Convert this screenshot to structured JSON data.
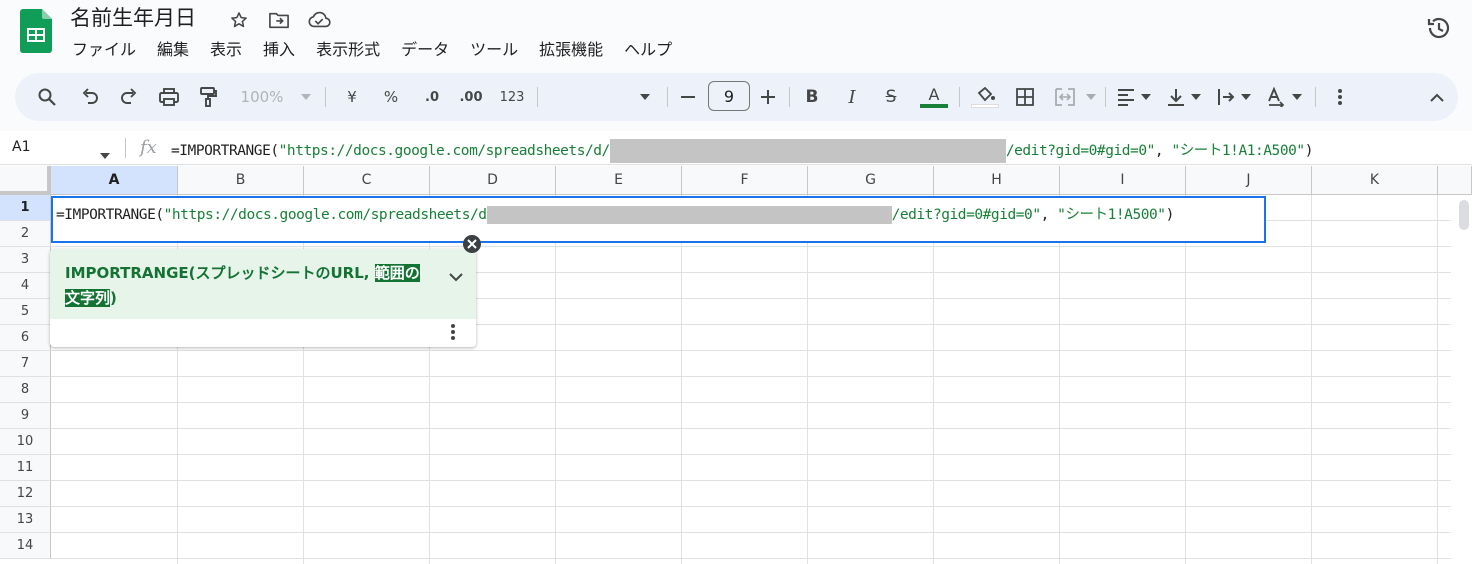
{
  "doc": {
    "title": "名前生年月日"
  },
  "menu": [
    "ファイル",
    "編集",
    "表示",
    "挿入",
    "表示形式",
    "データ",
    "ツール",
    "拡張機能",
    "ヘルプ"
  ],
  "toolbar": {
    "zoom": "100%",
    "currency": "¥",
    "percent": "%",
    "dec_decrease": ".0",
    "dec_increase": ".00",
    "number_format": "123",
    "font_size": "9"
  },
  "formula_bar": {
    "name_box": "A1",
    "fx": "fx",
    "formula_prefix": "=IMPORTRANGE(",
    "url_start": "\"https://docs.google.com/spreadsheets/d/",
    "url_end": "/edit?gid=0#gid=0\"",
    "sep": ", ",
    "range": "\"シート1!A1:A500\"",
    "close": ")"
  },
  "editor": {
    "formula_prefix": "=IMPORTRANGE(",
    "url_start": "\"https://docs.google.com/spreadsheets/d",
    "url_end": "/edit?gid=0#gid=0\"",
    "sep": ", ",
    "range": "\"シート1!A500\"",
    "close": ")"
  },
  "help": {
    "signature_prefix": "IMPORTRANGE(スプレッドシートのURL, ",
    "hl_arg_1": "範囲の",
    "hl_arg_2": "文字列",
    "signature_suffix": ")"
  },
  "grid": {
    "columns": [
      "A",
      "B",
      "C",
      "D",
      "E",
      "F",
      "G",
      "H",
      "I",
      "J",
      "K"
    ],
    "rows": [
      "1",
      "2",
      "3",
      "4",
      "5",
      "6",
      "7",
      "8",
      "9",
      "10",
      "11",
      "12",
      "13",
      "14"
    ],
    "selected_column": "A",
    "selected_row": "1"
  },
  "colors": {
    "accent": "#1a73e8",
    "string": "#188038",
    "sheets_green": "#0f9d58"
  }
}
